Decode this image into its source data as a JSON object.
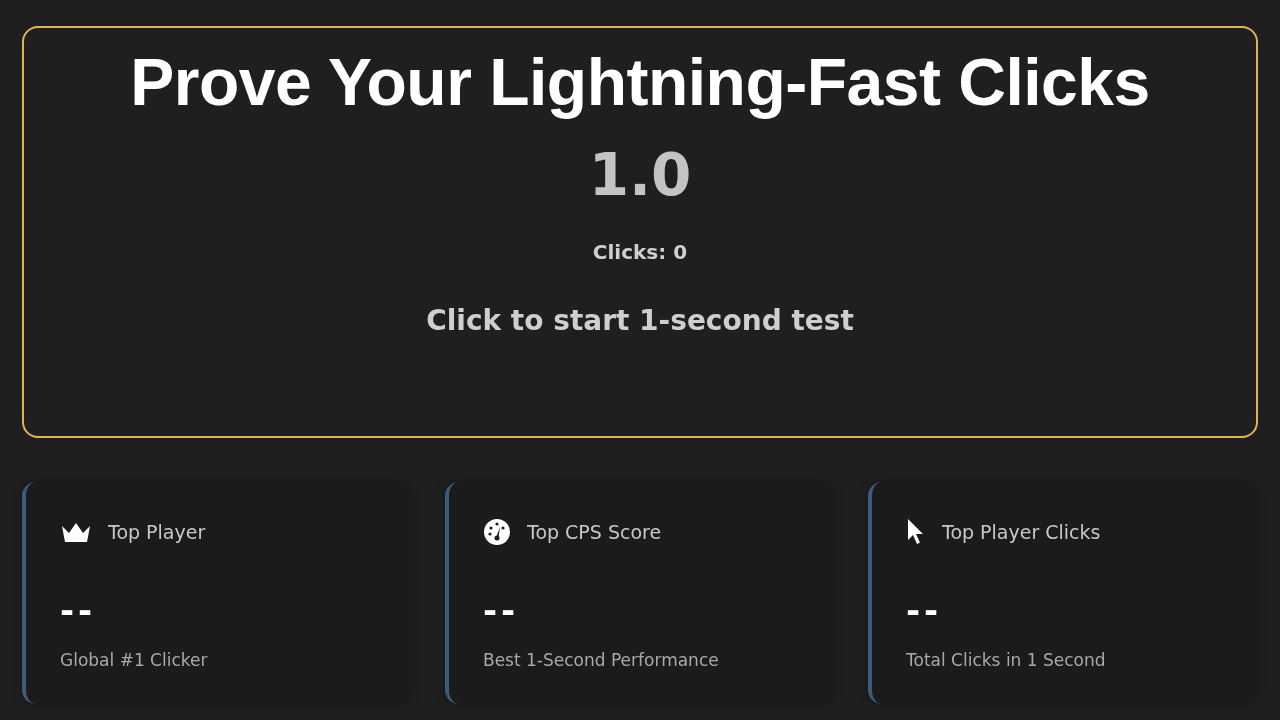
{
  "test_panel": {
    "title": "Prove Your Lightning-Fast Clicks",
    "timer": "1.0",
    "clicks": "Clicks: 0",
    "prompt": "Click to start 1-second test"
  },
  "stats": [
    {
      "label": "Top Player",
      "value": "--",
      "caption": "Global #1 Clicker"
    },
    {
      "label": "Top CPS Score",
      "value": "--",
      "caption": "Best 1-Second Performance"
    },
    {
      "label": "Top Player Clicks",
      "value": "--",
      "caption": "Total Clicks in 1 Second"
    }
  ]
}
